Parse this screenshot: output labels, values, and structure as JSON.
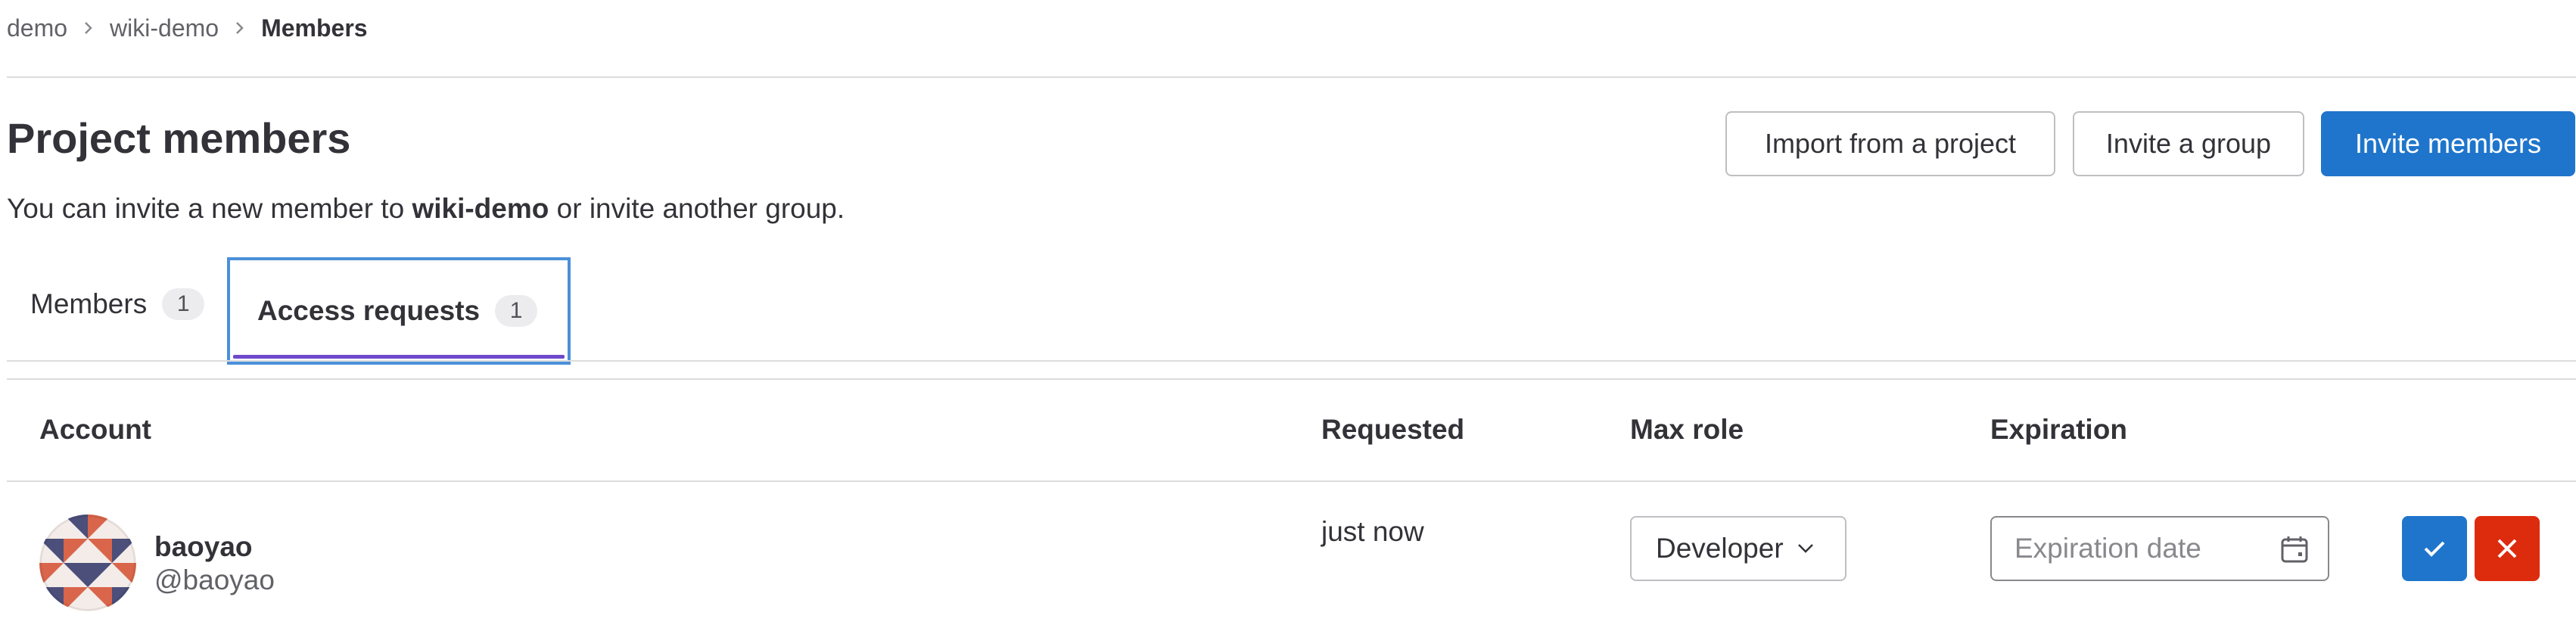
{
  "breadcrumb": {
    "items": [
      "demo",
      "wiki-demo"
    ],
    "current": "Members"
  },
  "header": {
    "title": "Project members",
    "desc_prefix": "You can invite a new member to ",
    "desc_project": "wiki-demo",
    "desc_suffix": " or invite another group."
  },
  "actions": {
    "import": "Import from a project",
    "invite_group": "Invite a group",
    "invite_members": "Invite members"
  },
  "tabs": [
    {
      "label": "Members",
      "count": "1"
    },
    {
      "label": "Access requests",
      "count": "1",
      "active": true
    }
  ],
  "table": {
    "headers": {
      "account": "Account",
      "requested": "Requested",
      "max_role": "Max role",
      "expiration": "Expiration"
    },
    "rows": [
      {
        "name": "baoyao",
        "username": "@baoyao",
        "requested": "just now",
        "role": "Developer",
        "expiration_placeholder": "Expiration date",
        "expiration_value": ""
      }
    ]
  },
  "colors": {
    "primary": "#1f75cb",
    "danger": "#dd2b0e",
    "active_tab": "#6e49cb"
  }
}
